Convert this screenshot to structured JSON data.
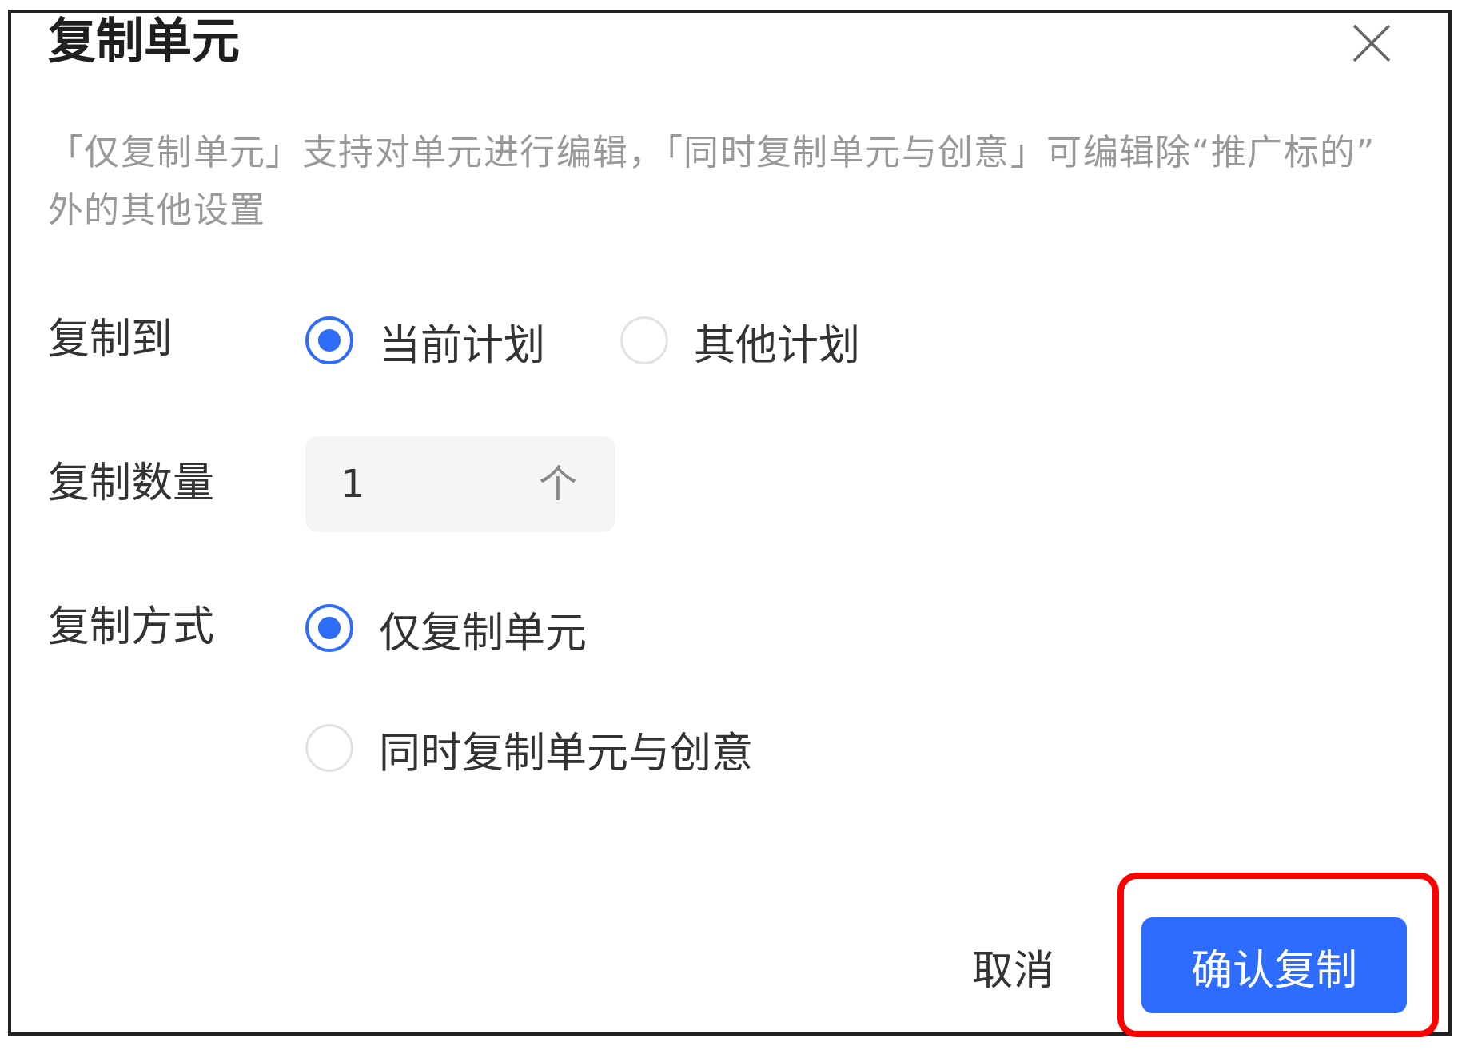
{
  "title": "复制单元",
  "description": "「仅复制单元」支持对单元进行编辑，「同时复制单元与创意」可编辑除“推广标的”外的其他设置",
  "fields": [
    {
      "kind": "radio-inline",
      "label": "复制到",
      "options": [
        {
          "label": "当前计划",
          "selected": true
        },
        {
          "label": "其他计划",
          "selected": false
        }
      ]
    },
    {
      "kind": "number",
      "label": "复制数量",
      "value": "1",
      "unit": "个"
    },
    {
      "kind": "radio-stacked",
      "label": "复制方式",
      "options": [
        {
          "label": "仅复制单元",
          "selected": true
        },
        {
          "label": "同时复制单元与创意",
          "selected": false
        }
      ]
    }
  ],
  "buttons": [
    {
      "kind": "text",
      "label": "取消",
      "highlighted": false
    },
    {
      "kind": "primary",
      "label": "确认复制",
      "highlighted": true
    }
  ]
}
